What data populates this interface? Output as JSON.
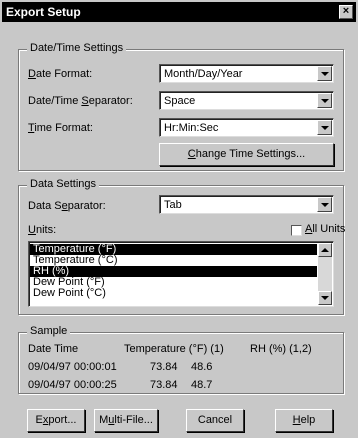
{
  "window": {
    "title": "Export Setup",
    "close_glyph": "×"
  },
  "datetime": {
    "group_label": "Date/Time Settings",
    "date_format": {
      "label_ul": "D",
      "label_rest": "ate Format:",
      "value": "Month/Day/Year"
    },
    "separator": {
      "label_pre": "Date/Time ",
      "label_ul": "S",
      "label_rest": "eparator:",
      "value": "Space"
    },
    "time_format": {
      "label_ul": "T",
      "label_rest": "ime Format:",
      "value": "Hr:Min:Sec"
    },
    "change_button": {
      "label_ul": "C",
      "label_rest": "hange Time Settings..."
    }
  },
  "data_settings": {
    "group_label": "Data Settings",
    "separator": {
      "label_pre": "Data S",
      "label_ul": "e",
      "label_rest": "parator:",
      "value": "Tab"
    },
    "units_label_ul": "U",
    "units_label_rest": "nits:",
    "all_units": {
      "label_ul": "A",
      "label_rest": "ll Units",
      "checked": false
    },
    "units_list": [
      {
        "label": "Temperature (°F)",
        "selected": true
      },
      {
        "label": "Temperature (°C)",
        "selected": false
      },
      {
        "label": "RH (%)",
        "selected": true
      },
      {
        "label": "Dew Point (°F)",
        "selected": false
      },
      {
        "label": "Dew Point (°C)",
        "selected": false
      }
    ]
  },
  "sample": {
    "group_label": "Sample",
    "header": {
      "c1": "Date Time",
      "c2": "Temperature (°F) (1)",
      "c3": "RH (%) (1,2)"
    },
    "rows": [
      {
        "datetime": "09/04/97 00:00:01",
        "temp": "73.84",
        "rh": "48.6"
      },
      {
        "datetime": "09/04/97 00:00:25",
        "temp": "73.84",
        "rh": "48.7"
      }
    ]
  },
  "buttons": {
    "export": {
      "pre": "E",
      "ul": "x",
      "rest": "port..."
    },
    "multi": {
      "pre": "M",
      "ul": "u",
      "rest": "lti-File..."
    },
    "cancel": {
      "label": "Cancel"
    },
    "help": {
      "ul": "H",
      "rest": "elp"
    }
  },
  "colors": {
    "dialog_bg": "#c8c8c8",
    "title_bg": "#000000",
    "selection_bg": "#000000"
  }
}
